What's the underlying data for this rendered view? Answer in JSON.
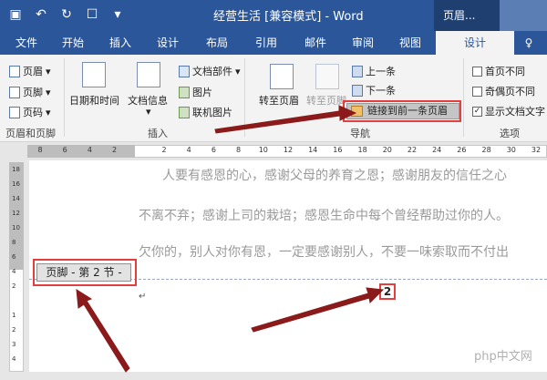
{
  "title_bar": {
    "doc_title": "经营生活 [兼容模式] - Word",
    "context_tab": "页眉...",
    "qat": {
      "save_icon": "save-icon",
      "undo_icon": "undo-icon",
      "redo_icon": "redo-icon",
      "touch_icon": "touch-mode-icon",
      "customize_icon": "customize-qat-icon"
    }
  },
  "tabs": [
    "文件",
    "开始",
    "插入",
    "设计",
    "布局",
    "引用",
    "邮件",
    "审阅",
    "视图",
    "设计"
  ],
  "active_tab": "设计",
  "ribbon": {
    "header_footer_group": {
      "label": "页眉和页脚",
      "items": [
        "页眉",
        "页脚",
        "页码"
      ]
    },
    "insert_group": {
      "label": "插入",
      "date_time": "日期和时间",
      "doc_info": "文档信息",
      "doc_parts": "文档部件",
      "picture": "图片",
      "online_picture": "联机图片"
    },
    "nav_group": {
      "label": "导航",
      "goto_header": "转至页眉",
      "goto_footer": "转至页脚",
      "previous": "上一条",
      "next": "下一条",
      "link_previous": "链接到前一条页眉"
    },
    "options_group": {
      "label": "选项",
      "first_page_diff": "首页不同",
      "odd_even_diff": "奇偶页不同",
      "show_doc_text": "显示文档文字"
    }
  },
  "ruler": {
    "ticks": [
      "8",
      "6",
      "4",
      "2",
      "",
      "2",
      "4",
      "6",
      "8",
      "10",
      "12",
      "14",
      "16",
      "18",
      "20",
      "22",
      "24",
      "26",
      "28",
      "30",
      "32"
    ],
    "vticks": [
      "18",
      "16",
      "14",
      "12",
      "10",
      "8",
      "6",
      "4",
      "2",
      "",
      "1",
      "2",
      "3",
      "4"
    ]
  },
  "document": {
    "lines": [
      "人要有感恩的心，感谢父母的养育之恩；感谢朋友的信任之心",
      "不离不弃；感谢上司的栽培；感恩生命中每个曾经帮助过你的人。",
      "欠你的，别人对你有恩，一定要感谢别人，不要一味索取而不付出"
    ],
    "footer_tag": "页脚 - 第 2 节 -",
    "page_number": "2",
    "cursor_mark": "↵"
  },
  "watermark": "php中文网",
  "colors": {
    "word_blue": "#2b579a",
    "highlight_red": "#e43e3e",
    "arrow": "#8b1a1a"
  }
}
